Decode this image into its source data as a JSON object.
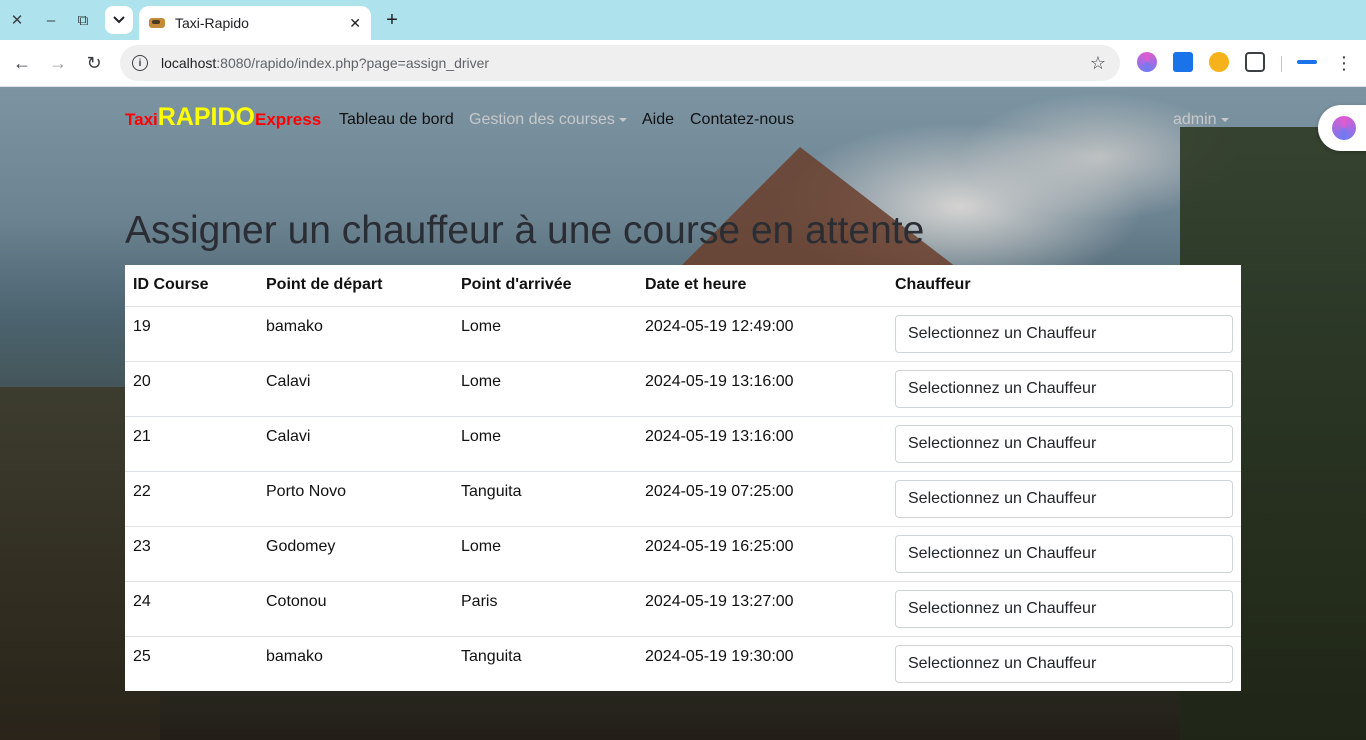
{
  "browser": {
    "tab_title": "Taxi-Rapido",
    "url_host": "localhost",
    "url_rest": ":8080/rapido/index.php?page=assign_driver"
  },
  "navbar": {
    "brand_part1": "Taxi",
    "brand_part2": "RAPIDO",
    "brand_part3": "Express",
    "links": [
      "Tableau de bord",
      "Gestion des courses",
      "Aide",
      "Contatez-nous"
    ],
    "user": "admin"
  },
  "page": {
    "heading": "Assigner un chauffeur à une course en attente"
  },
  "table": {
    "headers": [
      "ID Course",
      "Point de départ",
      "Point d'arrivée",
      "Date et heure",
      "Chauffeur"
    ],
    "select_placeholder": "Selectionnez un Chauffeur",
    "rows": [
      {
        "id": "19",
        "depart": "bamako",
        "arrivee": "Lome",
        "datetime": "2024-05-19 12:49:00"
      },
      {
        "id": "20",
        "depart": "Calavi",
        "arrivee": "Lome",
        "datetime": "2024-05-19 13:16:00"
      },
      {
        "id": "21",
        "depart": "Calavi",
        "arrivee": "Lome",
        "datetime": "2024-05-19 13:16:00"
      },
      {
        "id": "22",
        "depart": "Porto Novo",
        "arrivee": "Tanguita",
        "datetime": "2024-05-19 07:25:00"
      },
      {
        "id": "23",
        "depart": "Godomey",
        "arrivee": "Lome",
        "datetime": "2024-05-19 16:25:00"
      },
      {
        "id": "24",
        "depart": "Cotonou",
        "arrivee": "Paris",
        "datetime": "2024-05-19 13:27:00"
      },
      {
        "id": "25",
        "depart": "bamako",
        "arrivee": "Tanguita",
        "datetime": "2024-05-19 19:30:00"
      }
    ]
  }
}
